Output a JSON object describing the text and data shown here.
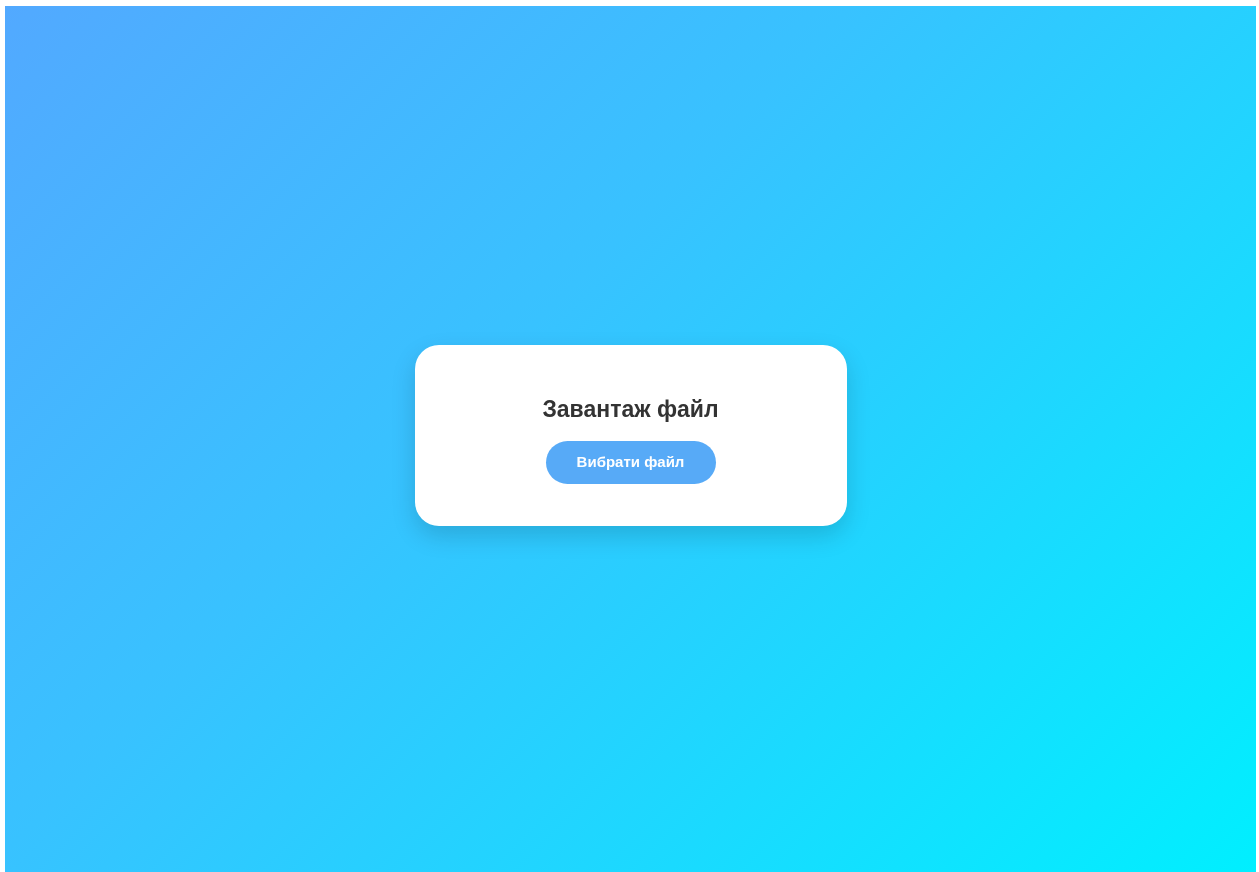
{
  "card": {
    "title": "Завантаж файл",
    "button": "Вибрати файл"
  }
}
